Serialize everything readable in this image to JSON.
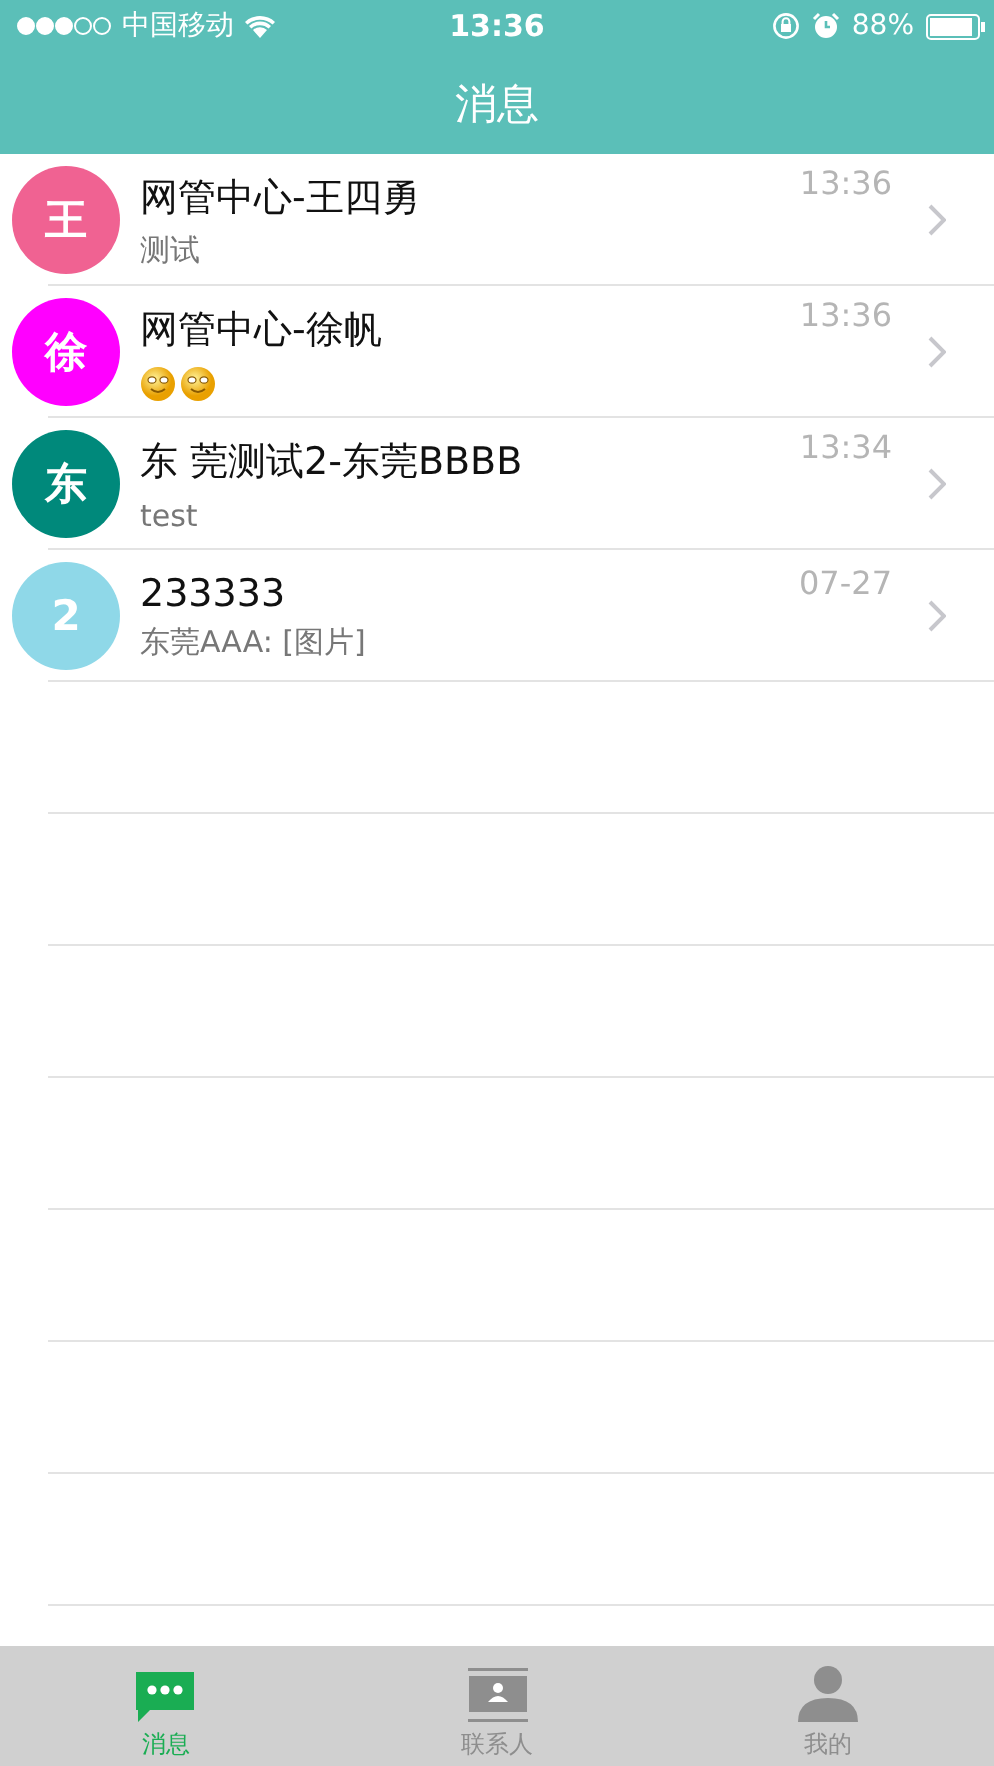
{
  "status_bar": {
    "carrier": "中国移动",
    "time": "13:36",
    "battery": "88%"
  },
  "header": {
    "title": "消息"
  },
  "conversations": [
    {
      "avatar": "王",
      "color": "#f06292",
      "name": "网管中心-王四勇",
      "time": "13:36",
      "preview": "测试"
    },
    {
      "avatar": "徐",
      "color": "#ff00ff",
      "name": "网管中心-徐帆",
      "time": "13:36",
      "preview_icons": [
        {
          "kind": "smiley"
        },
        {
          "kind": "smiley"
        }
      ]
    },
    {
      "avatar": "东",
      "color": "#00897b",
      "name": "东 莞测试2-东莞BBBB",
      "time": "13:34",
      "preview": "test"
    },
    {
      "avatar": "2",
      "color": "#8fd8e8",
      "name": "233333",
      "time": "07-27",
      "preview": "东莞AAA: [图片]"
    }
  ],
  "tab_bar": [
    {
      "kind": "chat",
      "label": "消息",
      "selected": true
    },
    {
      "kind": "contacts",
      "label": "联系人",
      "selected": false
    },
    {
      "kind": "profile",
      "label": "我的",
      "selected": false
    }
  ]
}
